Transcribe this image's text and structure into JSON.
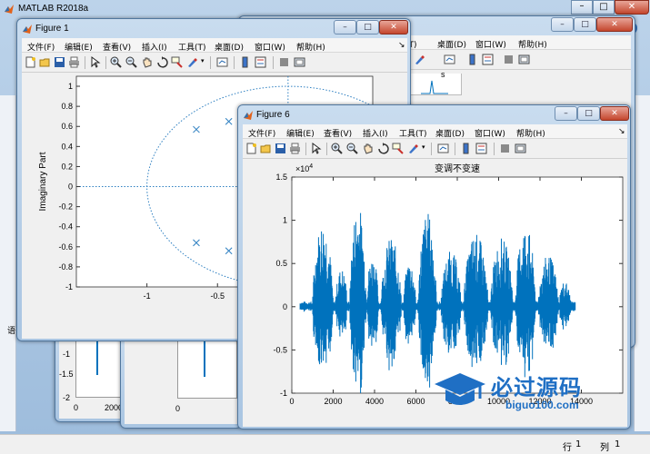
{
  "matlab_window": {
    "title": "MATLAB R2018a",
    "status_row_label": "行",
    "status_row_value": "1",
    "status_col_label": "列",
    "status_col_value": "1",
    "left_edge_label": "语",
    "right_edge_label": "索"
  },
  "menu": {
    "file": "文件(F)",
    "edit": "编辑(E)",
    "view": "查看(V)",
    "insert": "插入(I)",
    "tools": "工具(T)",
    "desktop": "桌面(D)",
    "window": "窗口(W)",
    "help": "帮助(H)",
    "arrow": "↘"
  },
  "back_figure": {
    "menu_tools": "工具(T)",
    "menu_desktop": "桌面(D)",
    "menu_window": "窗口(W)",
    "menu_help": "帮助(H)",
    "plot_fragment": "s"
  },
  "figure1": {
    "title": "Figure 1",
    "xlabel": "Real Part",
    "ylabel": "Imaginary Part",
    "zero_multiplicity": "10",
    "yticks": [
      "1",
      "0.8",
      "0.6",
      "0.4",
      "0.2",
      "0",
      "-0.2",
      "-0.4",
      "-0.6",
      "-0.8",
      "-1"
    ],
    "xticks": [
      "-1",
      "-0.5",
      "0"
    ]
  },
  "bottom_plots": {
    "yticks": [
      "-1",
      "-1.5",
      "-2"
    ],
    "xticks_left": [
      "0",
      "2000"
    ],
    "xticks_mid": [
      "0"
    ]
  },
  "figure6": {
    "title": "Figure 6",
    "plot_title": "变调不变速",
    "exponent_base": "×10",
    "exponent_power": "4",
    "yticks": [
      "1.5",
      "1",
      "0.5",
      "0",
      "-0.5",
      "-1"
    ],
    "xticks": [
      "0",
      "2000",
      "4000",
      "6000",
      "8000",
      "10000",
      "12000",
      "14000"
    ]
  },
  "chart_data": [
    {
      "type": "scatter",
      "title": "",
      "xlabel": "Real Part",
      "ylabel": "Imaginary Part",
      "xlim": [
        -1.5,
        0.6
      ],
      "ylim": [
        -1.0,
        1.1
      ],
      "unit_circle": true,
      "poles": [
        {
          "x": 0.02,
          "y": 0.78
        },
        {
          "x": 0.02,
          "y": -0.77
        },
        {
          "x": -0.42,
          "y": 0.65
        },
        {
          "x": -0.42,
          "y": -0.64
        },
        {
          "x": -0.65,
          "y": 0.57
        },
        {
          "x": -0.65,
          "y": -0.56
        }
      ],
      "zeros": [
        {
          "x": 0.0,
          "y": 0.0,
          "multiplicity": 10
        }
      ]
    },
    {
      "type": "line",
      "title": "变调不变速",
      "xlim": [
        0,
        16000
      ],
      "ylim": [
        -1.0,
        1.5
      ],
      "y_scale_factor": 10000,
      "bursts": [
        {
          "start": 1000,
          "end": 2000,
          "amp": 1.0
        },
        {
          "start": 2100,
          "end": 2700,
          "amp": 0.45
        },
        {
          "start": 2800,
          "end": 3600,
          "amp": 1.2
        },
        {
          "start": 3600,
          "end": 4200,
          "amp": 0.6
        },
        {
          "start": 4300,
          "end": 5300,
          "amp": 0.8
        },
        {
          "start": 5400,
          "end": 6000,
          "amp": 0.55
        },
        {
          "start": 6100,
          "end": 7000,
          "amp": 1.1
        },
        {
          "start": 7200,
          "end": 8200,
          "amp": 0.65
        },
        {
          "start": 8300,
          "end": 9500,
          "amp": 0.85
        },
        {
          "start": 9600,
          "end": 10700,
          "amp": 0.8
        },
        {
          "start": 10800,
          "end": 11800,
          "amp": 0.95
        },
        {
          "start": 11900,
          "end": 12900,
          "amp": 0.6
        },
        {
          "start": 12900,
          "end": 13500,
          "amp": 0.3
        }
      ],
      "noise_floor": 0.06,
      "line_color": "#0072bd"
    }
  ],
  "watermark": {
    "logo_text": "必过源码",
    "url_text": "biguo100.com"
  },
  "colors": {
    "plot_line": "#0072bd",
    "marker": "#2d7fc1",
    "axes_bg": "#ffffff",
    "figure_bg": "#f0f0f0",
    "desktop_bg": "#6fa0c8"
  }
}
